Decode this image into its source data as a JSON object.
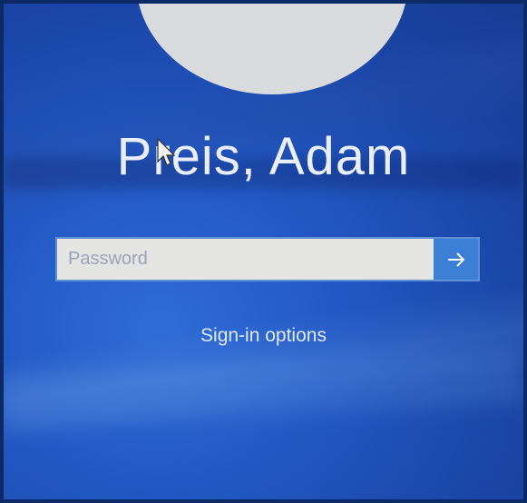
{
  "user": {
    "name": "Preis, Adam"
  },
  "password": {
    "placeholder": "Password",
    "value": ""
  },
  "submit": {
    "icon": "arrow-right-icon"
  },
  "signin_options": {
    "label": "Sign-in options"
  },
  "colors": {
    "background": "#2358c4",
    "avatar": "#d8dade",
    "input_bg": "#e4e4e2",
    "submit_bg": "#3c7fd6",
    "text": "#e8eefb"
  }
}
